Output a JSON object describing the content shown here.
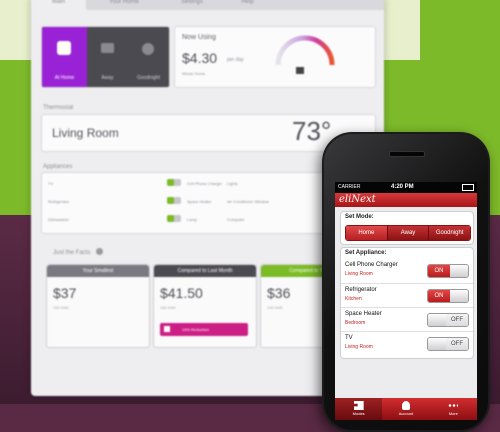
{
  "dashboard": {
    "tabs": [
      "Main",
      "Your Home",
      "Settings",
      "Help"
    ],
    "mode_buttons": [
      "At Home",
      "Away",
      "Goodnight"
    ],
    "now_using": {
      "title": "Now Using",
      "price": "$4.30",
      "unit": "per day",
      "sub": "Whole Home"
    },
    "thermostat": {
      "section": "Thermostat",
      "room": "Living Room",
      "temp": "73°"
    },
    "appliances": {
      "section": "Appliances",
      "left": [
        "TV",
        "Refrigerator",
        "Dishwasher"
      ],
      "middle": [
        "Cell Phone Charger",
        "Space Heater",
        "Lamp"
      ],
      "right": [
        "Lights",
        "Air Conditioner Window",
        "Computer"
      ]
    },
    "parts": {
      "section": "Just the Facts",
      "boxes": [
        {
          "head": "Your Smallest",
          "value": "$37",
          "sub": "150 kWh"
        },
        {
          "head": "Compared to Last Month",
          "value": "$41.50",
          "sub": "160 kWh",
          "badge": "15% Reduction"
        },
        {
          "head": "Compared to Yr Ago",
          "value": "$36",
          "sub": "140 kWh"
        }
      ]
    },
    "colors": {
      "accent": "#8b1ec7",
      "green": "#7bbb25",
      "magenta": "#cc1f86"
    }
  },
  "phone": {
    "status": {
      "carrier": "CARRIER",
      "time": "4:20 PM"
    },
    "app_title": "eliNext",
    "mode": {
      "title": "Set Mode:",
      "options": [
        "Home",
        "Away",
        "Goodnight"
      ],
      "selected": "Home"
    },
    "appliance_title": "Set Appliance:",
    "appliances": [
      {
        "name": "Cell Phone Charger",
        "room": "Living Room",
        "state": "ON"
      },
      {
        "name": "Refrigerator",
        "room": "Kitchen",
        "state": "ON"
      },
      {
        "name": "Space Heater",
        "room": "Bedroom",
        "state": "OFF"
      },
      {
        "name": "TV",
        "room": "Living Room",
        "state": "OFF"
      }
    ],
    "tabs": [
      "Modes",
      "Account",
      "More"
    ],
    "colors": {
      "red": "#c62a2d"
    }
  }
}
